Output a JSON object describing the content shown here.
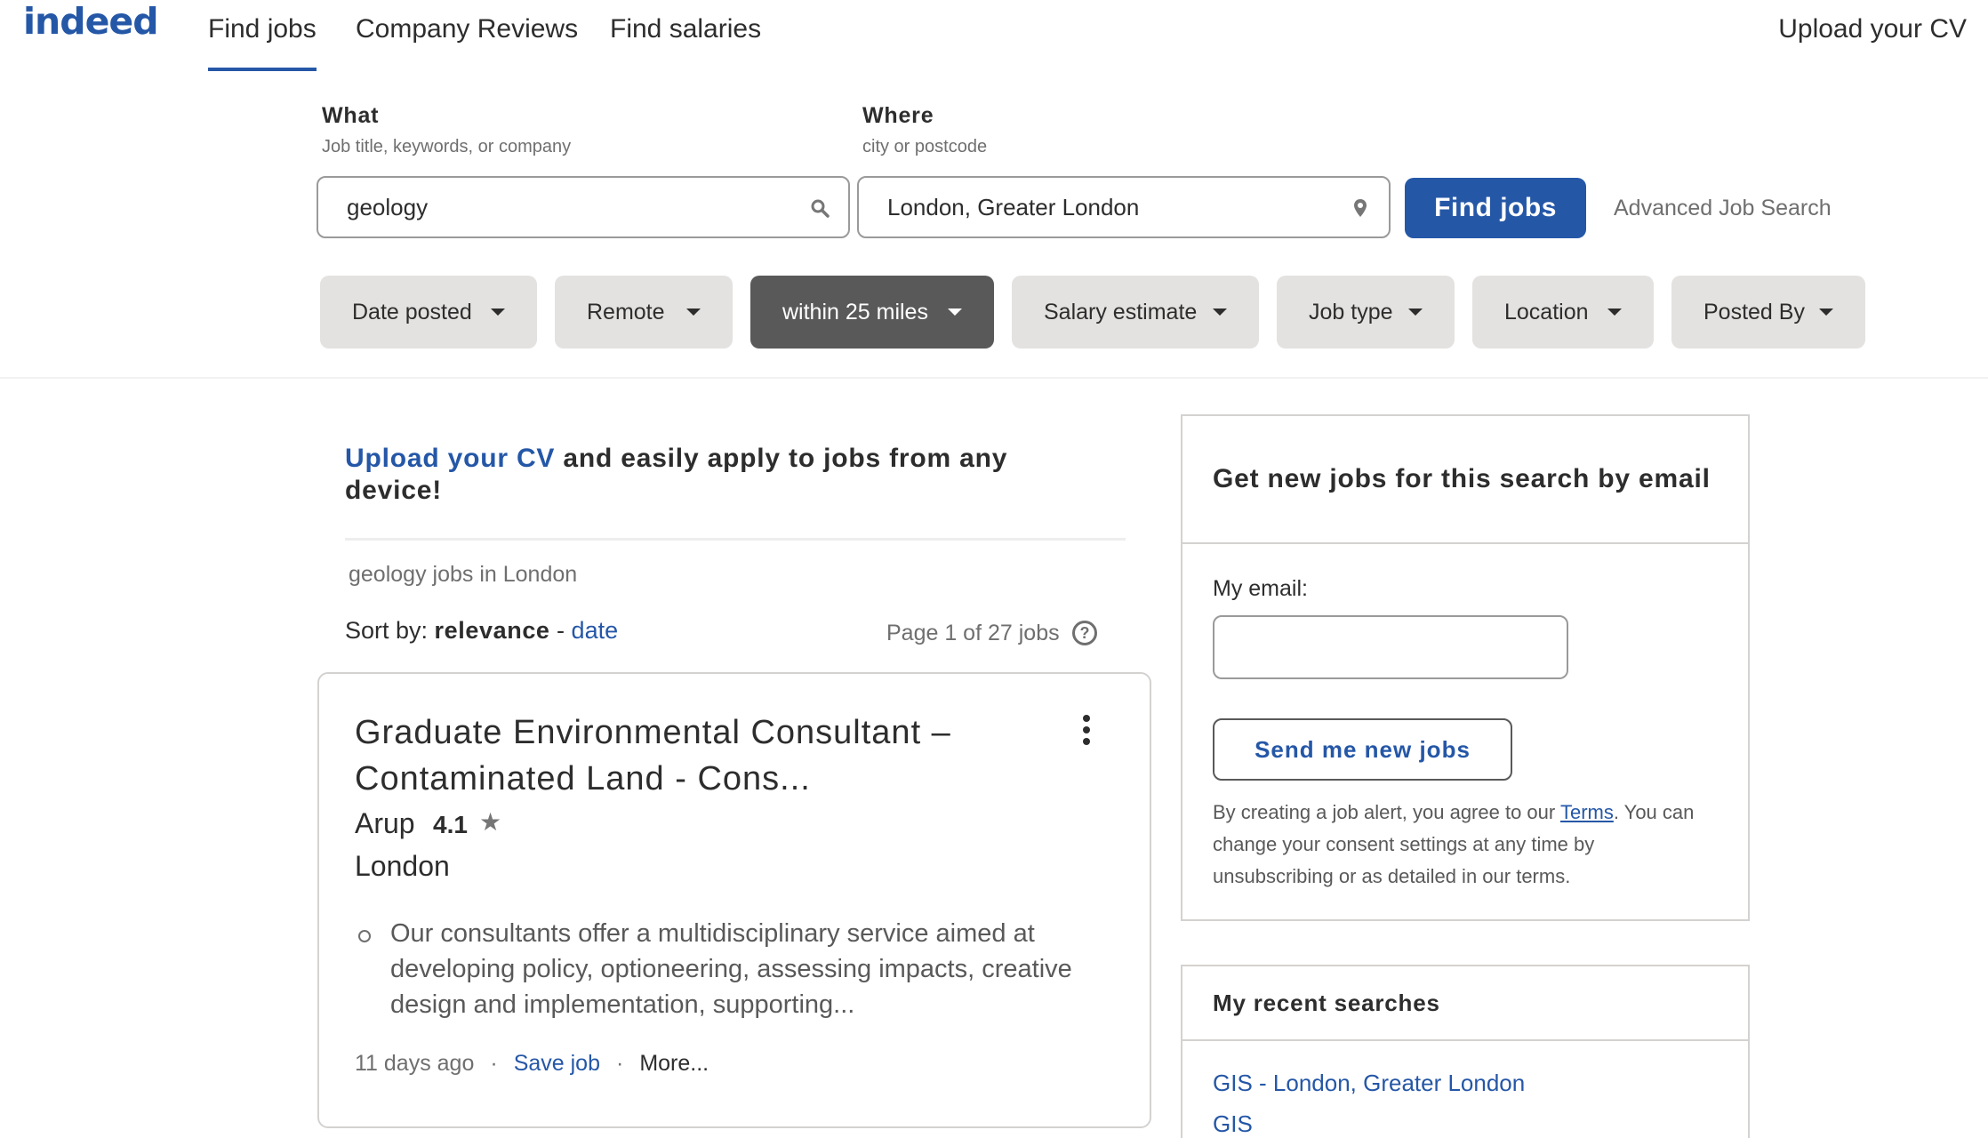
{
  "header": {
    "logo": "indeed",
    "tabs": [
      {
        "label": "Find jobs",
        "active": true
      },
      {
        "label": "Company Reviews",
        "active": false
      },
      {
        "label": "Find salaries",
        "active": false
      }
    ],
    "upload_cv": "Upload your CV"
  },
  "search": {
    "what": {
      "title": "What",
      "hint": "Job title, keywords, or company",
      "value": "geology",
      "icon": "search-icon"
    },
    "where": {
      "title": "Where",
      "hint": "city or postcode",
      "value": "London, Greater London",
      "icon": "location-pin-icon"
    },
    "find_button": "Find jobs",
    "advanced_link": "Advanced Job Search"
  },
  "filters": [
    {
      "label": "Date posted",
      "active": false
    },
    {
      "label": "Remote",
      "active": false
    },
    {
      "label": "within 25 miles",
      "active": true
    },
    {
      "label": "Salary estimate",
      "active": false
    },
    {
      "label": "Job type",
      "active": false
    },
    {
      "label": "Location",
      "active": false
    },
    {
      "label": "Posted By",
      "active": false
    }
  ],
  "promo": {
    "link_text": "Upload your CV",
    "rest_text": " and easily apply to jobs from any device!"
  },
  "results": {
    "heading": "geology jobs in London",
    "sort_prefix": "Sort by: ",
    "sort_current": "relevance",
    "sort_sep": " - ",
    "sort_alt": "date",
    "page_info": "Page 1 of 27 jobs",
    "help_icon": "?"
  },
  "job": {
    "title": "Graduate Environmental Consultant – Contaminated Land - Cons...",
    "company": "Arup",
    "rating": "4.1",
    "star": "★",
    "location": "London",
    "snippet": "Our consultants offer a multidisciplinary service aimed at developing policy, optioneering, assessing impacts, creative design and implementation, supporting...",
    "posted": "11 days ago",
    "sep": "·",
    "save": "Save job",
    "more": "More..."
  },
  "alert": {
    "title": "Get new jobs for this search by email",
    "email_label": "My email:",
    "email_value": "",
    "button": "Send me new jobs",
    "terms_before": "By creating a job alert, you agree to our ",
    "terms_link": "Terms",
    "terms_after": ". You can change your consent settings at any time by unsubscribing or as detailed in our terms."
  },
  "recent": {
    "title": "My recent searches",
    "items": [
      "GIS - London, Greater London",
      "GIS"
    ]
  },
  "colors": {
    "brand": "#2557a7",
    "active_filter": "#595959",
    "filter_bg": "#e4e2e0"
  }
}
